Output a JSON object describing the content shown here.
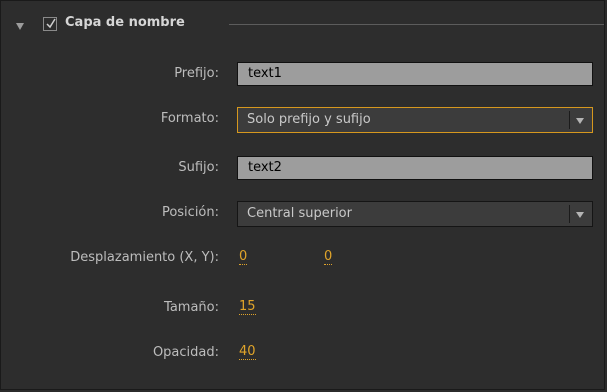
{
  "section": {
    "title": "Capa de nombre",
    "checked": true
  },
  "fields": {
    "prefijo": {
      "label": "Prefijo:",
      "value": "text1"
    },
    "formato": {
      "label": "Formato:",
      "value": "Solo prefijo y sufijo"
    },
    "sufijo": {
      "label": "Sufijo:",
      "value": "text2"
    },
    "posicion": {
      "label": "Posición:",
      "value": "Central superior"
    },
    "desplazamiento": {
      "label": "Desplazamiento (X, Y):",
      "x": "0",
      "y": "0"
    },
    "tamano": {
      "label": "Tamaño:",
      "value": "15"
    },
    "opacidad": {
      "label": "Opacidad:",
      "value": "40"
    }
  },
  "colors": {
    "accent": "#e0a42a",
    "focus_border": "#d6981e",
    "panel_bg": "#2d2d2d"
  }
}
